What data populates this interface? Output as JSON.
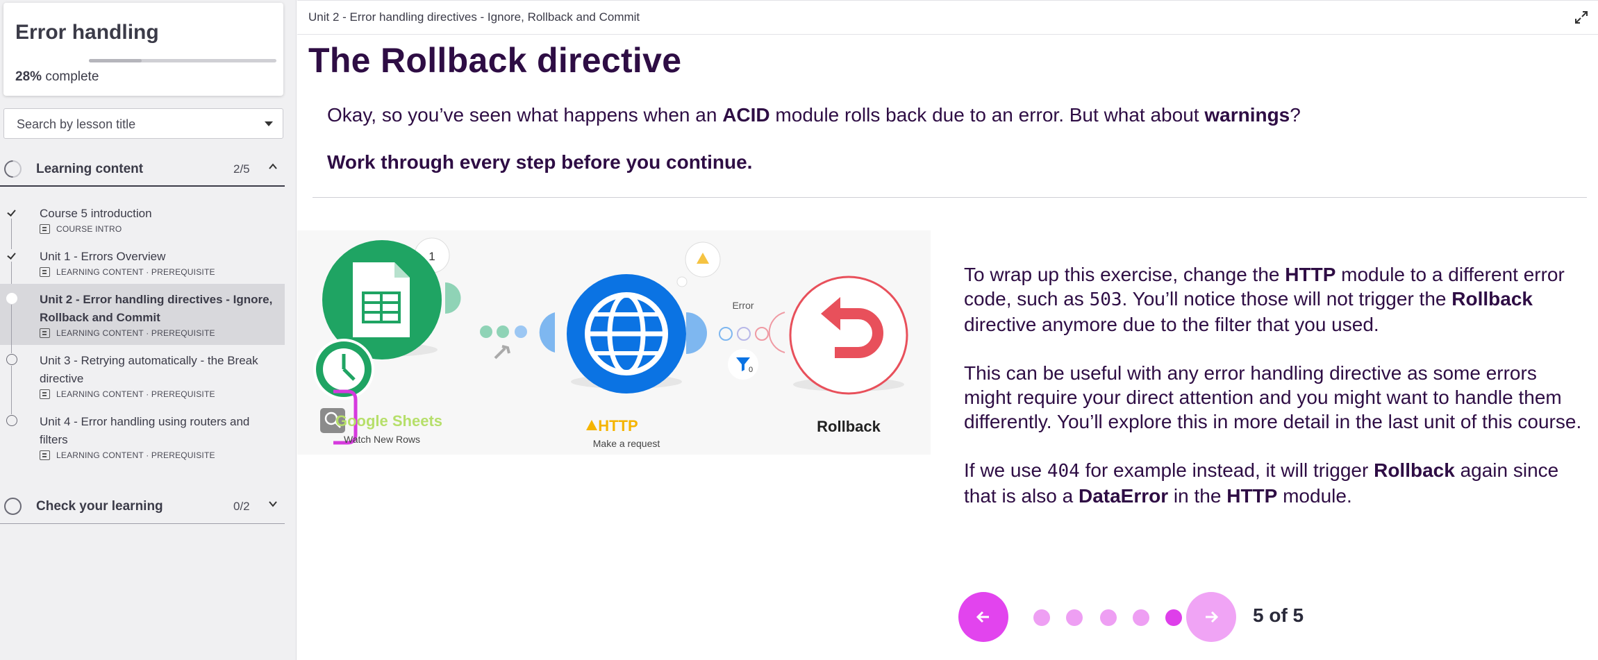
{
  "sidebar": {
    "course_title": "Error handling",
    "progress_percent": 28,
    "progress_pct_text": "28%",
    "progress_suffix": "complete",
    "search_placeholder": "Search by lesson title",
    "sections": [
      {
        "title": "Learning content",
        "count": "2/5",
        "expanded": true
      },
      {
        "title": "Check your learning",
        "count": "0/2",
        "expanded": false
      }
    ],
    "lessons": [
      {
        "title": "Course 5 introduction",
        "meta": "COURSE INTRO",
        "state": "done"
      },
      {
        "title": "Unit 1 - Errors Overview",
        "meta": "LEARNING CONTENT · PREREQUISITE",
        "state": "done"
      },
      {
        "title": "Unit 2 - Error handling directives - Ignore, Rollback and Commit",
        "meta": "LEARNING CONTENT · PREREQUISITE",
        "state": "current"
      },
      {
        "title": "Unit 3 - Retrying automatically - the Break directive",
        "meta": "LEARNING CONTENT · PREREQUISITE",
        "state": "open"
      },
      {
        "title": "Unit 4 - Error handling using routers and filters",
        "meta": "LEARNING CONTENT · PREREQUISITE",
        "state": "open"
      }
    ]
  },
  "main": {
    "breadcrumb": "Unit 2 - Error handling directives - Ignore, Rollback and Commit",
    "title": "The Rollback directive",
    "intro": {
      "pre": "Okay, so you’ve seen what happens when an ",
      "b1": "ACID",
      "mid": " module rolls back due to an error. But what about ",
      "b2": "warnings",
      "post": "?"
    },
    "instruction": "Work through every step before you continue.",
    "scenario": {
      "module1_name": "Google Sheets",
      "module1_action": "Watch New Rows",
      "module1_bubble": "1",
      "module2_name": "HTTP",
      "module2_action": "Make a request",
      "error_label": "Error",
      "filter_count": "0",
      "module3_name": "Rollback"
    },
    "paragraphs": {
      "p1": {
        "a": "To wrap up this exercise, change the ",
        "b": "HTTP",
        "c": " module to a different error code, such as ",
        "code": "503",
        "d": ". You’ll notice those will not trigger the ",
        "e": "Rollback",
        "f": " directive anymore due to the filter that you used."
      },
      "p2": "This can be useful with any error handling directive as some errors might require your direct attention and you might want to handle them differently. You’ll explore this in more detail in the last unit of this course.",
      "p3": {
        "a": "If we use ",
        "code": "404",
        "b": " for example instead, it will trigger ",
        "c": "Rollback",
        "d": " again since that is also a ",
        "e": "DataError",
        "f": " in the ",
        "g": "HTTP",
        "h": " module."
      }
    },
    "pager": {
      "current": 5,
      "total": 5,
      "label": "5 of 5"
    }
  },
  "colors": {
    "accent": "#e244ee",
    "accent_light": "#f0a4f5",
    "title": "#2e0d44",
    "sheets_green": "#1fa463",
    "http_blue": "#0b73e3",
    "rollback_red": "#e8505b"
  }
}
